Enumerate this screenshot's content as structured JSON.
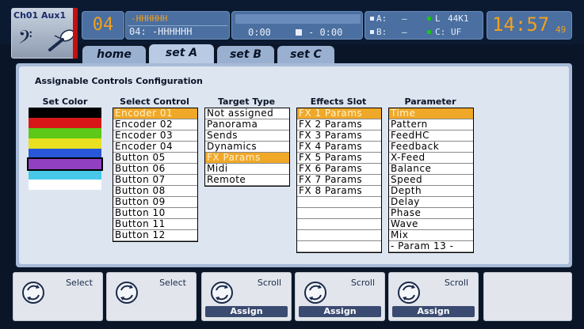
{
  "status": {
    "channel": "Ch01 Aux1",
    "clef": "𝄢",
    "scene_number": "04",
    "scene_name_edit": "-HHHHHH",
    "scene_name": "04: -HHHHHH",
    "time_elapsed": "0:00",
    "time_remaining": "- 0:00",
    "io": {
      "a_label": "A:",
      "a_value": "–",
      "b_label": "B:",
      "b_value": "–",
      "l_label": "L",
      "l_value": "44K1",
      "c_label": "C:",
      "c_value": "UF"
    },
    "clock": "14:57",
    "clock_seconds": "49",
    "colors": {
      "accent": "#f0a020",
      "green_dot": "#20c020",
      "white_dot": "#e8eef8"
    }
  },
  "tabs": [
    {
      "label": "home",
      "active": false
    },
    {
      "label": "set A",
      "active": true
    },
    {
      "label": "set B",
      "active": false
    },
    {
      "label": "set C",
      "active": false
    }
  ],
  "panel": {
    "title": "Assignable Controls Configuration",
    "columns": {
      "set_color": "Set Color",
      "select_control": "Select Control",
      "target_type": "Target Type",
      "effects_slot": "Effects Slot",
      "parameter": "Parameter"
    },
    "colors": [
      "#000000",
      "#d81818",
      "#5cc818",
      "#e8e020",
      "#2858d8",
      "#9040c0",
      "#48c8e8",
      "#ffffff"
    ],
    "selected_color_index": 5,
    "select_control": [
      "Encoder 01",
      "Encoder 02",
      "Encoder 03",
      "Encoder 04",
      "Button  05",
      "Button  06",
      "Button  07",
      "Button  08",
      "Button  09",
      "Button  10",
      "Button  11",
      "Button  12"
    ],
    "select_control_selected": 0,
    "target_type": [
      "Not assigned",
      "Panorama",
      "Sends",
      "Dynamics",
      "FX Params",
      "Midi",
      "Remote"
    ],
    "target_type_selected": 4,
    "effects_slot": [
      "FX 1 Params",
      "FX 2 Params",
      "FX 3 Params",
      "FX 4 Params",
      "FX 5 Params",
      "FX 6 Params",
      "FX 7 Params",
      "FX 8 Params",
      "",
      "",
      "",
      "",
      ""
    ],
    "effects_slot_selected": 0,
    "parameter": [
      "Time",
      "Pattern",
      "FeedHC",
      "Feedback",
      "X-Feed",
      "Balance",
      "Speed",
      "Depth",
      "Delay",
      "Phase",
      "Wave",
      "Mix",
      "- Param 13 -"
    ],
    "parameter_selected": 0
  },
  "buttons": [
    {
      "label": "Select",
      "assign": ""
    },
    {
      "label": "Select",
      "assign": ""
    },
    {
      "label": "Scroll",
      "assign": "Assign"
    },
    {
      "label": "Scroll",
      "assign": "Assign"
    },
    {
      "label": "Scroll",
      "assign": "Assign"
    },
    {
      "label": "",
      "assign": ""
    }
  ]
}
